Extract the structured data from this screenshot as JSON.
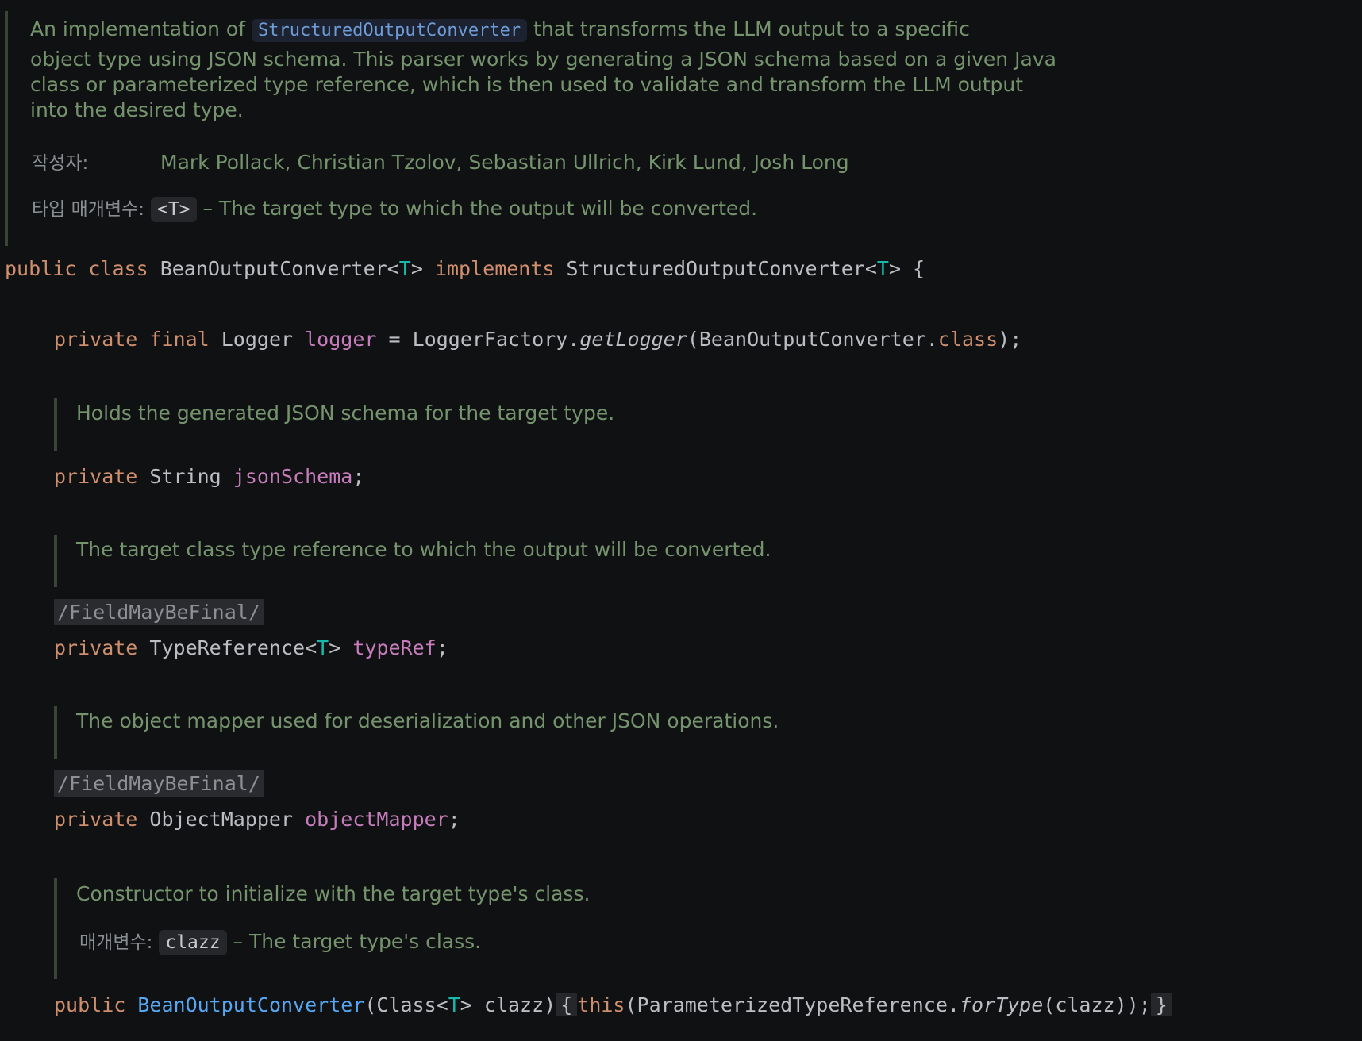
{
  "class_doc": {
    "line1_before": "An implementation of ",
    "line1_link": "StructuredOutputConverter",
    "line1_after": " that transforms the LLM output to a specific",
    "line2": "object type using JSON schema. This parser works by generating a JSON schema based on a given Java",
    "line3": "class or parameterized type reference, which is then used to validate and transform the LLM output",
    "line4": "into the desired type.",
    "author_label": "작성자:",
    "authors": "Mark Pollack, Christian Tzolov, Sebastian Ullrich, Kirk Lund, Josh Long",
    "type_param_label": "타입 매개변수:",
    "type_param_chip": "<T>",
    "type_param_desc": " – The target type to which the output will be converted."
  },
  "class_decl": {
    "kw_public": "public",
    "kw_class": "class",
    "name": "BeanOutputConverter",
    "lt1": "<",
    "t1": "T",
    "gt1": ">",
    "kw_implements": "implements",
    "iface": "StructuredOutputConverter",
    "lt2": "<",
    "t2": "T",
    "gt2": ">",
    "brace": "{"
  },
  "logger_line": {
    "kw_private": "private",
    "kw_final": "final",
    "type": "Logger",
    "field": "logger",
    "eq": "=",
    "factory": "LoggerFactory.",
    "method": "getLogger",
    "arg_open": "(BeanOutputConverter.",
    "kw_class": "class",
    "close": ");"
  },
  "json_schema_doc": "Holds the generated JSON schema for the target type.",
  "json_schema_line": {
    "kw_private": "private",
    "type": "String",
    "field": "jsonSchema",
    "semi": ";"
  },
  "type_ref_doc": "The target class type reference to which the output will be converted.",
  "type_ref_annotation": "/FieldMayBeFinal/",
  "type_ref_line": {
    "kw_private": "private",
    "type": "TypeReference",
    "lt": "<",
    "t": "T",
    "gt": ">",
    "field": "typeRef",
    "semi": ";"
  },
  "mapper_doc": "The object mapper used for deserialization and other JSON operations.",
  "mapper_annotation": "/FieldMayBeFinal/",
  "mapper_line": {
    "kw_private": "private",
    "type": "ObjectMapper",
    "field": "objectMapper",
    "semi": ";"
  },
  "ctor_doc": {
    "line1": "Constructor to initialize with the target type's class.",
    "param_label": "매개변수:",
    "param_chip": "clazz",
    "param_desc": " – The target type's class."
  },
  "ctor_line": {
    "kw_public": "public",
    "name": "BeanOutputConverter",
    "params_open": "(Class<",
    "t": "T",
    "params_close": "> clazz)",
    "brace_open": "{",
    "kw_this": "this",
    "body": "(ParameterizedTypeReference.",
    "method": "forType",
    "body_end": "(clazz));",
    "brace_close": "}"
  },
  "colors": {
    "background": "#101113",
    "comment": "#75946d",
    "keyword": "#cf8e6d",
    "field": "#c77dbb",
    "type_param": "#16baac",
    "method_decl": "#56a8f5",
    "plain": "#bcbec4"
  }
}
